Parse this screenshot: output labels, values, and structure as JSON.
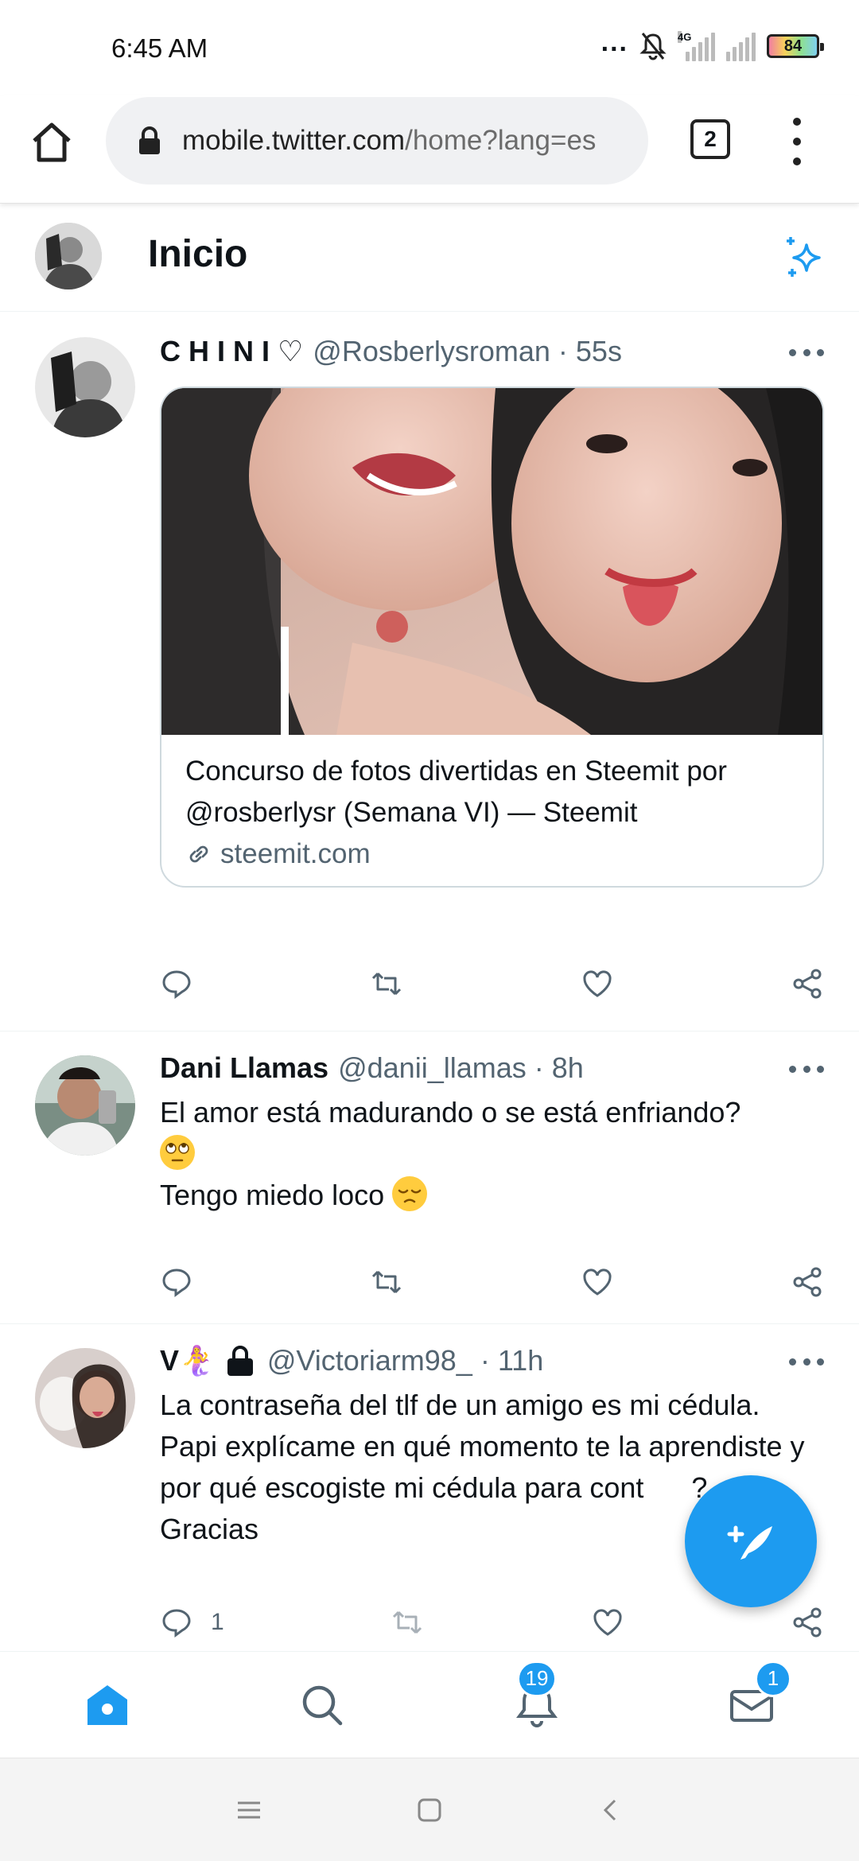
{
  "status_bar": {
    "time": "6:45 AM",
    "dots": "...",
    "network_label": "4G",
    "battery": "84"
  },
  "browser": {
    "url_host": "mobile.twitter.com",
    "url_path": "/home?lang=es",
    "tab_count": "2"
  },
  "header": {
    "title": "Inicio"
  },
  "tweets": [
    {
      "name": "C H I N I ♡",
      "handle": "@Rosberlysroman",
      "time": "· 55s",
      "card_title": "Concurso de fotos divertidas en Steemit por @rosberlysr (Semana VI) — Steemit",
      "card_domain": "steemit.com"
    },
    {
      "name": "Dani Llamas",
      "handle": "@danii_llamas",
      "time": "· 8h",
      "text_line1": "El amor está madurando o se está enfriando?",
      "text_line2": "Tengo miedo loco"
    },
    {
      "name": "V🧜‍♀️",
      "handle": "@Victoriarm98_",
      "time": "· 11h",
      "text": "La contraseña del tlf de un amigo es mi cédula. Papi explícame en qué momento te la aprendiste y por qué escogiste mi cédula para cont",
      "text_tail": "?",
      "text_last": "Gracias",
      "reply_count": "1"
    }
  ],
  "bottom_nav": {
    "notifications_badge": "19",
    "messages_badge": "1"
  },
  "colors": {
    "accent": "#1d9bf0",
    "secondary_text": "#536471"
  }
}
